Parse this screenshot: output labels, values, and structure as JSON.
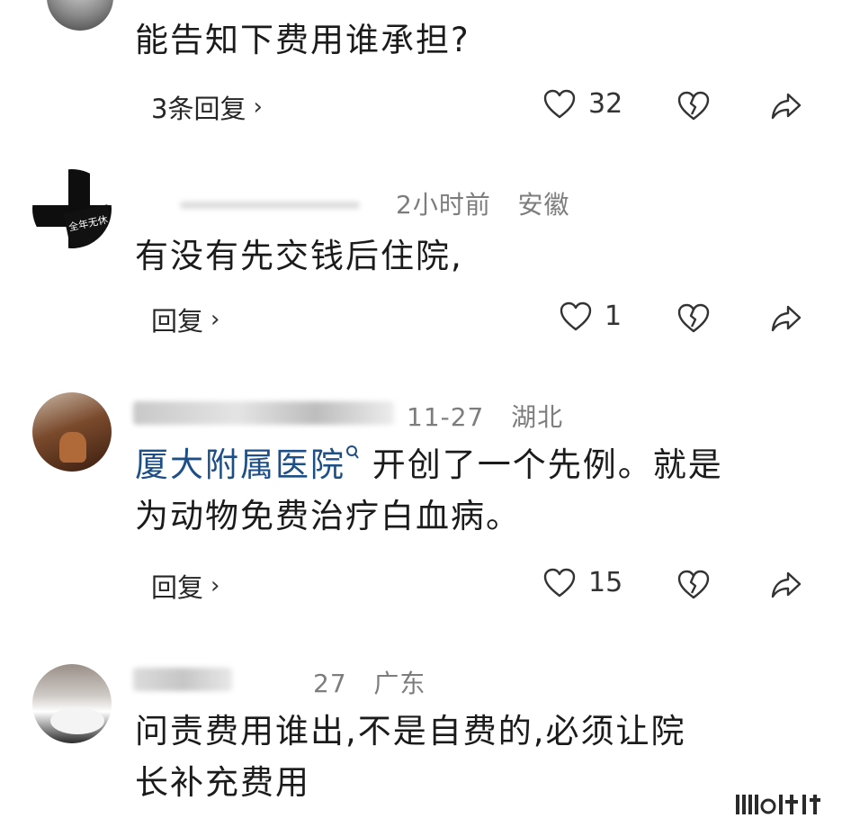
{
  "comments": [
    {
      "text": "能告知下费用谁承担?",
      "reply_label": "3条回复",
      "likes": "32"
    },
    {
      "time": "2小时前",
      "region": "安徽",
      "text": "有没有先交钱后住院,",
      "reply_label": "回复",
      "likes": "1"
    },
    {
      "time": "11-27",
      "region": "湖北",
      "link_text": "厦大附属医院",
      "text_after_link": "开创了一个先例。就是",
      "text_line2": "为动物免费治疗白血病。",
      "reply_label": "回复",
      "likes": "15"
    },
    {
      "time": "27",
      "region": "广东",
      "text_line1": "问责费用谁出,不是自费的,必须让院",
      "text_line2": "长补充费用"
    }
  ],
  "avatar_badge_text": "全年无休",
  "chevron": "›",
  "icons": {
    "like": "heart-outline-icon",
    "dislike": "broken-heart-icon",
    "share": "share-arrow-icon",
    "search": "search-icon"
  }
}
